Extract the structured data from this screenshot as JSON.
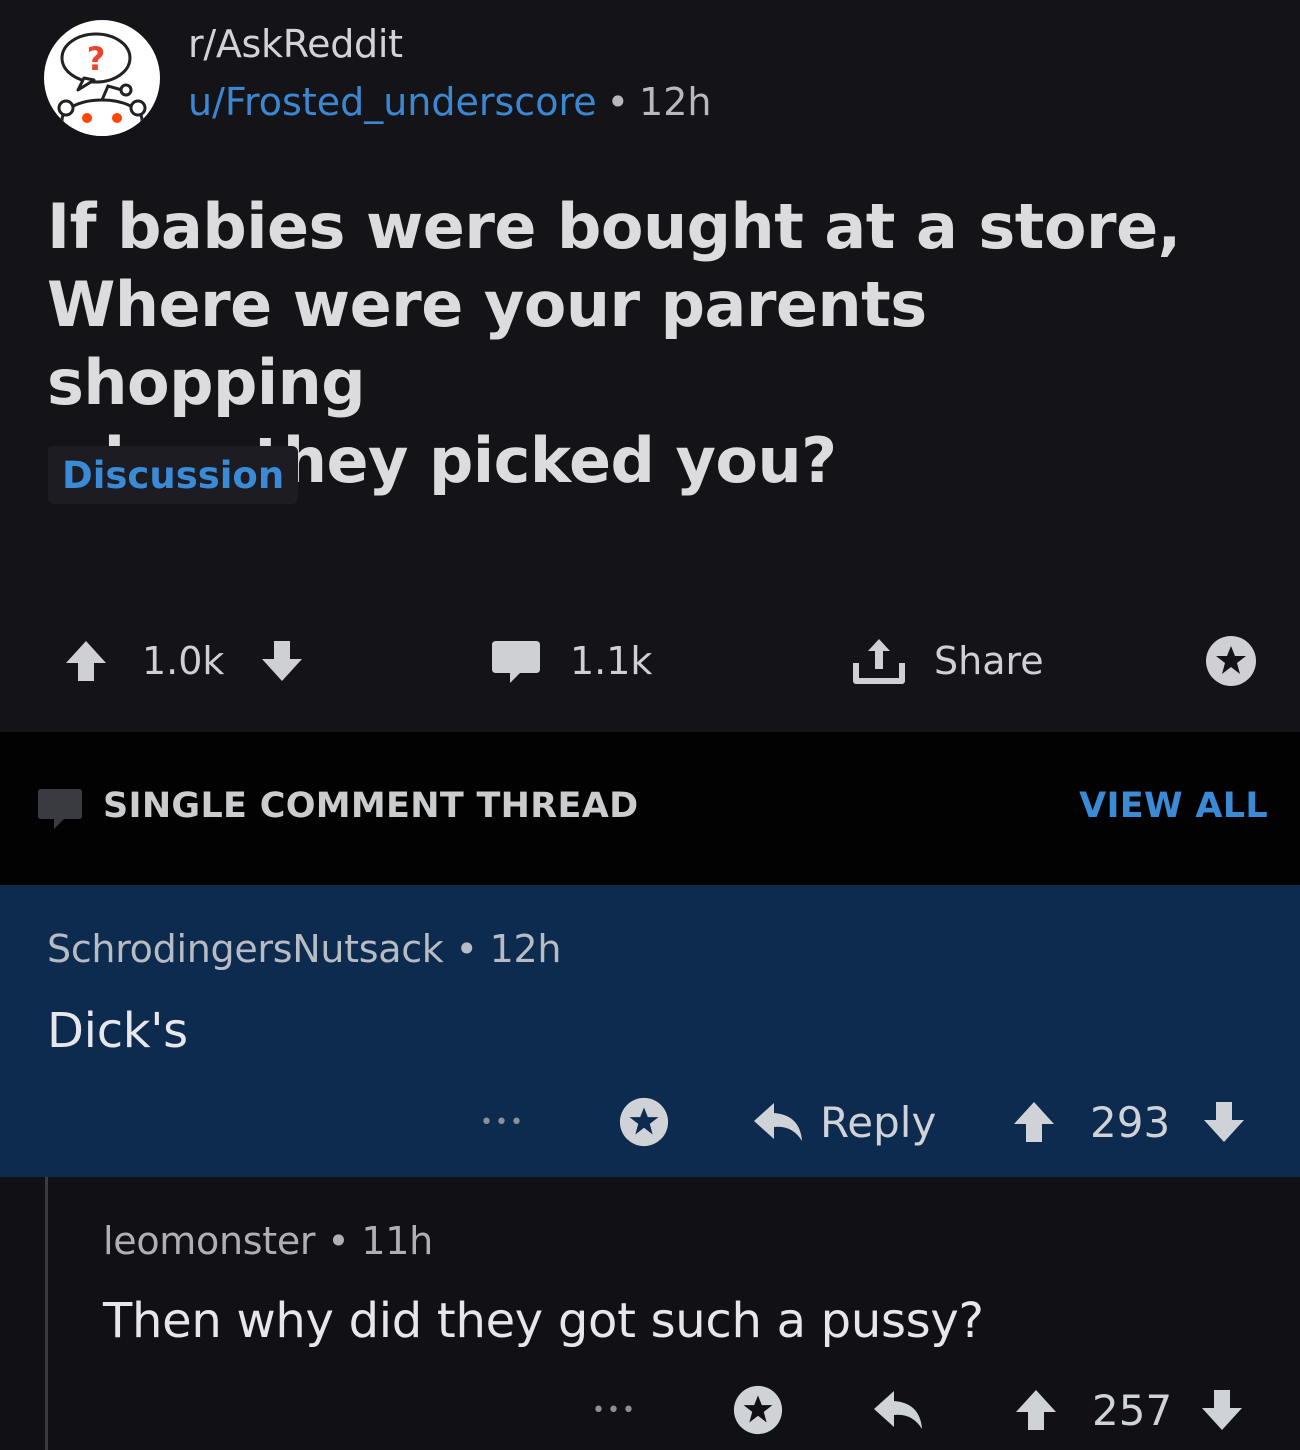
{
  "post": {
    "subreddit": "r/AskReddit",
    "author": "u/Frosted_underscore",
    "separator": "•",
    "time": "12h",
    "title_lines": [
      "If babies were bought at a store,",
      "Where were your parents shopping",
      "when they picked you?"
    ],
    "flair": "Discussion",
    "votes": "1.0k",
    "comments": "1.1k",
    "share_label": "Share"
  },
  "thread_header": {
    "label": "SINGLE COMMENT THREAD",
    "view_all": "VIEW ALL"
  },
  "comment": {
    "author": "SchrodingersNutsack",
    "separator": "•",
    "time": "12h",
    "body": "Dick's",
    "more": "•••",
    "reply_label": "Reply",
    "votes": "293"
  },
  "reply": {
    "author": "leomonster",
    "separator": "•",
    "time": "11h",
    "body": "Then why did they got such a pussy?",
    "more": "•••",
    "votes": "257"
  },
  "colors": {
    "background": "#111115",
    "link_blue": "#3a8ad6",
    "highlight": "#0c2b4f",
    "thread_header_bg": "#020203"
  }
}
